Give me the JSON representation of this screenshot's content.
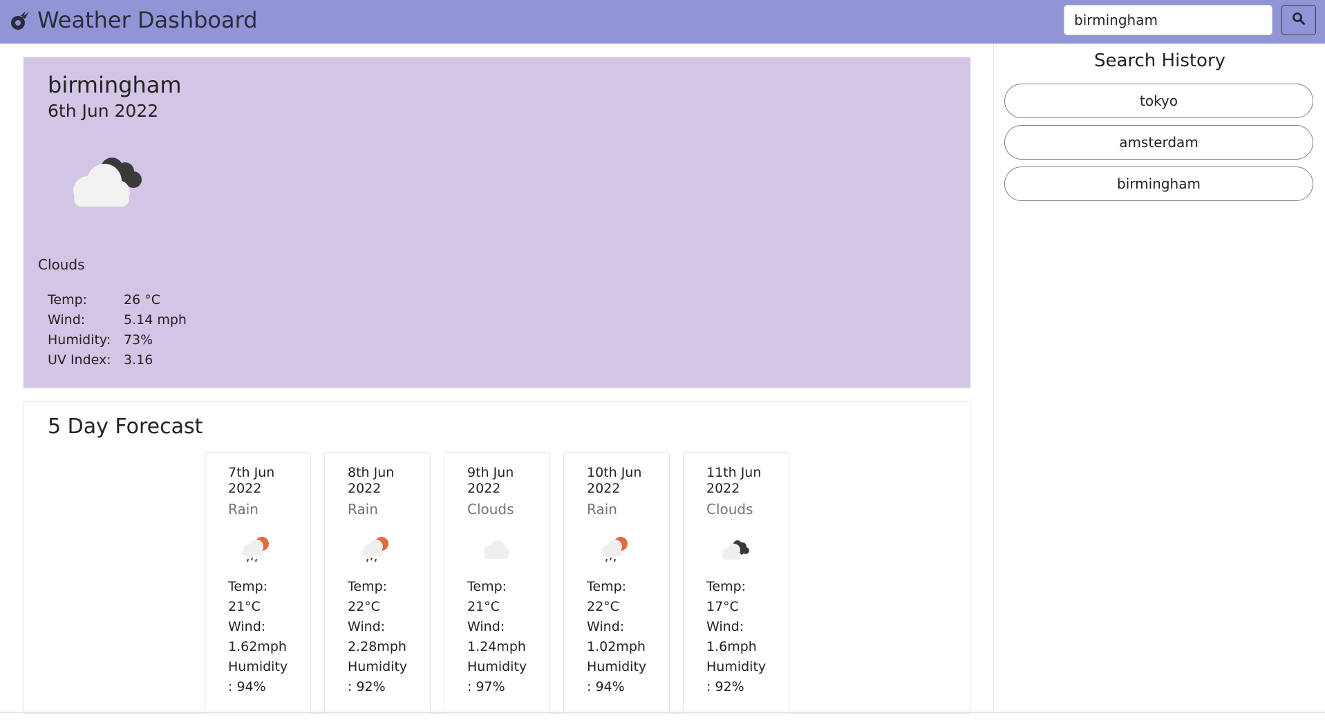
{
  "header": {
    "title": "Weather Dashboard",
    "search_value": "birmingham",
    "brand_icon": "comet-icon",
    "search_icon": "search-icon"
  },
  "current": {
    "city": "birmingham",
    "date": "6th Jun 2022",
    "condition": "Clouds",
    "icon": "broken-clouds-icon",
    "stats": [
      {
        "label": "Temp:",
        "value": "26 °C"
      },
      {
        "label": "Wind:",
        "value": "5.14 mph"
      },
      {
        "label": "Humidity:",
        "value": "73%"
      },
      {
        "label": "UV Index:",
        "value": "3.16"
      }
    ]
  },
  "forecast": {
    "title": "5 Day Forecast",
    "days": [
      {
        "date": "7th Jun 2022",
        "condition": "Rain",
        "icon": "rain-icon",
        "temp_label": "Temp:",
        "temp": "21°C",
        "wind_label": "Wind:",
        "wind": "1.62mph",
        "humidity_label": "Humidity",
        "humidity": ": 94%"
      },
      {
        "date": "8th Jun 2022",
        "condition": "Rain",
        "icon": "rain-icon",
        "temp_label": "Temp:",
        "temp": "22°C",
        "wind_label": "Wind:",
        "wind": "2.28mph",
        "humidity_label": "Humidity",
        "humidity": ": 92%"
      },
      {
        "date": "9th Jun 2022",
        "condition": "Clouds",
        "icon": "cloud-icon",
        "temp_label": "Temp:",
        "temp": "21°C",
        "wind_label": "Wind:",
        "wind": "1.24mph",
        "humidity_label": "Humidity",
        "humidity": ": 97%"
      },
      {
        "date": "10th Jun 2022",
        "condition": "Rain",
        "icon": "rain-icon",
        "temp_label": "Temp:",
        "temp": "22°C",
        "wind_label": "Wind:",
        "wind": "1.02mph",
        "humidity_label": "Humidity",
        "humidity": ": 94%"
      },
      {
        "date": "11th Jun 2022",
        "condition": "Clouds",
        "icon": "broken-clouds-icon",
        "temp_label": "Temp:",
        "temp": "17°C",
        "wind_label": "Wind:",
        "wind": "1.6mph",
        "humidity_label": "Humidity",
        "humidity": ": 92%"
      }
    ]
  },
  "sidebar": {
    "title": "Search History",
    "history": [
      {
        "label": "tokyo"
      },
      {
        "label": "amsterdam"
      },
      {
        "label": "birmingham"
      }
    ]
  },
  "colors": {
    "navbar": "#9195d6",
    "current_card": "#d3c5e6",
    "rain_sun": "#e0693f"
  }
}
